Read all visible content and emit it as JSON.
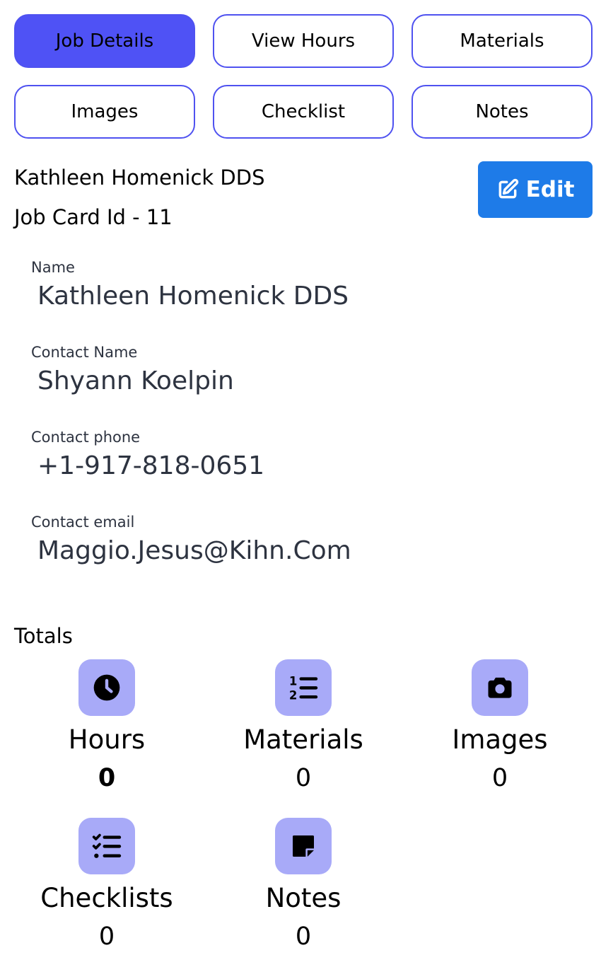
{
  "tabs": [
    {
      "label": "Job Details",
      "active": true
    },
    {
      "label": "View Hours",
      "active": false
    },
    {
      "label": "Materials",
      "active": false
    },
    {
      "label": "Images",
      "active": false
    },
    {
      "label": "Checklist",
      "active": false
    },
    {
      "label": "Notes",
      "active": false
    }
  ],
  "header": {
    "client_title": "Kathleen Homenick DDS",
    "job_card_id": "Job Card Id - 11",
    "edit_label": "Edit",
    "edit_icon": "edit-icon"
  },
  "fields": {
    "name": {
      "label": "Name",
      "value": "Kathleen Homenick DDS"
    },
    "contact_name": {
      "label": "Contact Name",
      "value": "Shyann Koelpin"
    },
    "contact_phone": {
      "label": "Contact phone",
      "value": "+1-917-818-0651"
    },
    "contact_email": {
      "label": "Contact email",
      "value": "Maggio.Jesus@Kihn.Com"
    }
  },
  "totals": {
    "title": "Totals",
    "items": [
      {
        "label": "Hours",
        "count": "0",
        "icon": "clock-icon"
      },
      {
        "label": "Materials",
        "count": "0",
        "icon": "numbered-list-icon"
      },
      {
        "label": "Images",
        "count": "0",
        "icon": "camera-icon"
      },
      {
        "label": "Checklists",
        "count": "0",
        "icon": "checklist-icon"
      },
      {
        "label": "Notes",
        "count": "0",
        "icon": "sticky-note-icon"
      }
    ]
  },
  "colors": {
    "accent": "#4f52f5",
    "edit_button": "#1e7be8",
    "icon_tile": "#a8aaf8",
    "field_text": "#2d3340"
  }
}
